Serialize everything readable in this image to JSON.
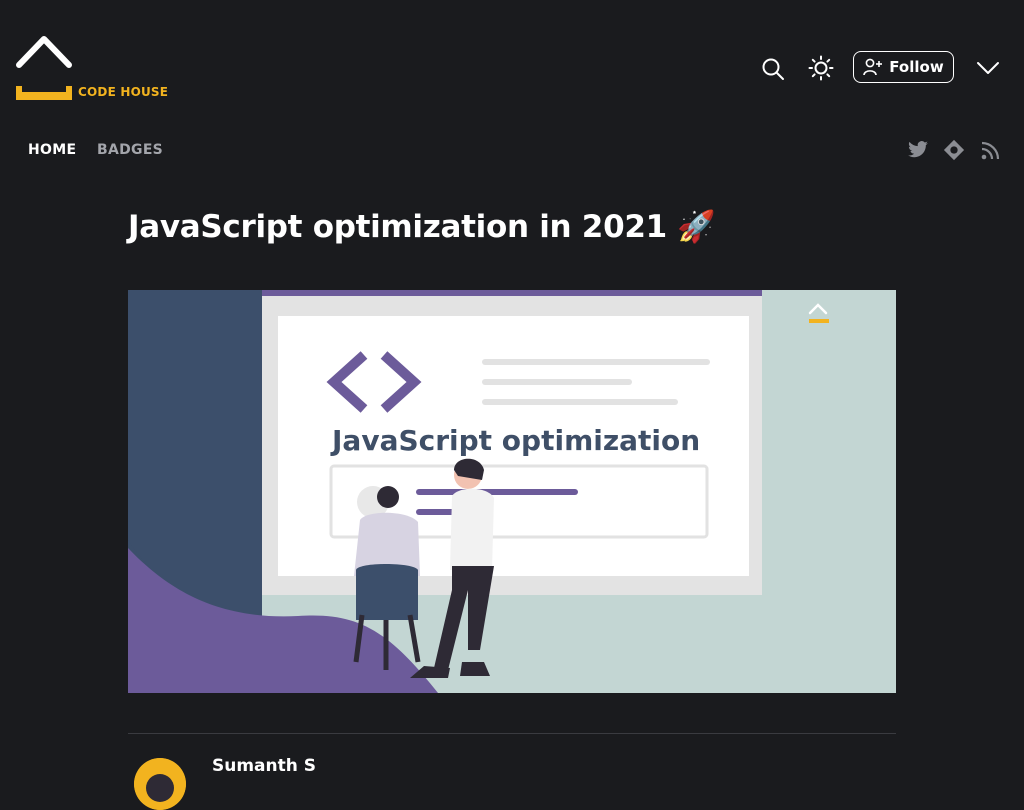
{
  "brand": {
    "name": "CODE HOUSE",
    "accent_color": "#f2b31f"
  },
  "header": {
    "search_icon": "search-icon",
    "theme_icon": "sun-icon",
    "follow_label": "Follow",
    "follow_icon": "user-plus-icon",
    "menu_icon": "chevron-down-icon"
  },
  "nav": {
    "items": [
      {
        "label": "HOME",
        "active": true
      },
      {
        "label": "BADGES",
        "active": false
      }
    ],
    "social_icons": [
      "twitter-icon",
      "hashnode-icon",
      "rss-icon"
    ]
  },
  "article": {
    "title": "JavaScript optimization in 2021 🚀",
    "cover": {
      "heading": "JavaScript optimization",
      "colors": {
        "bg_left": "#3c4f6b",
        "bg_right": "#c3d6d3",
        "wave": "#6c5b9a",
        "board_frame": "#e3e3e3",
        "board": "#ffffff",
        "code_symbol": "#6c5b9a",
        "text": "#3f4f67"
      }
    },
    "author": {
      "name": "Sumanth S"
    }
  }
}
